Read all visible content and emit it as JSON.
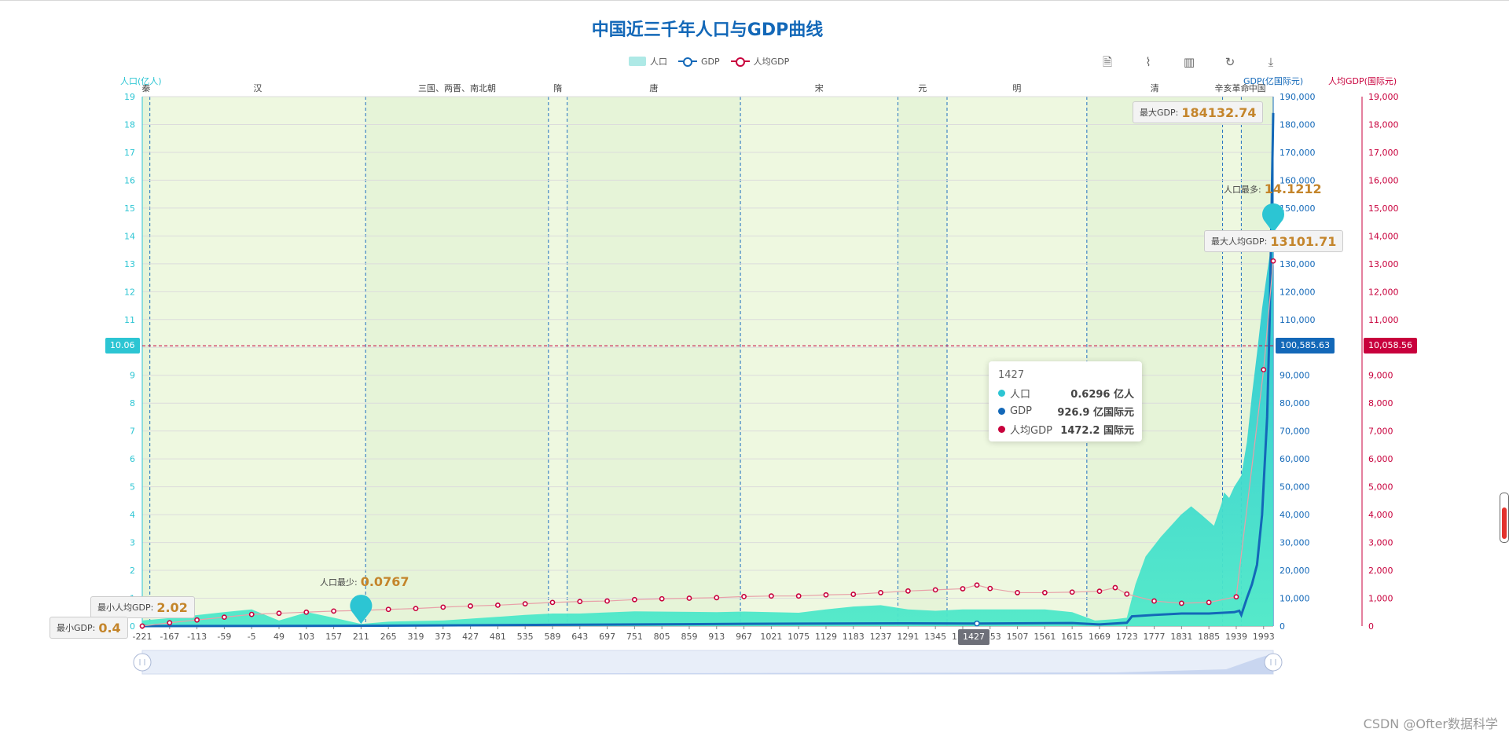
{
  "title": "中国近三千年人口与GDP曲线",
  "legend": [
    {
      "label": "人口",
      "color": "#2cc5d3"
    },
    {
      "label": "GDP",
      "color": "#1368b8"
    },
    {
      "label": "人均GDP",
      "color": "#c8003c"
    }
  ],
  "toolbox": [
    {
      "name": "data-view-icon",
      "glyph": "🗎"
    },
    {
      "name": "line-chart-icon",
      "glyph": "⌇"
    },
    {
      "name": "bar-chart-icon",
      "glyph": "▥"
    },
    {
      "name": "restore-icon",
      "glyph": "↻"
    },
    {
      "name": "save-image-icon",
      "glyph": "⤓"
    }
  ],
  "colors": {
    "population": "#2cc5d3",
    "gdp": "#1368b8",
    "gdp_per_capita": "#c8003c",
    "dynasty_band_1": "#e6f4d8",
    "dynasty_band_2": "#eef8e0"
  },
  "chart_data": {
    "type": "line",
    "title": "中国近三千年人口与GDP曲线",
    "x_tick_labels": [
      "-221",
      "-167",
      "-113",
      "-59",
      "-5",
      "49",
      "103",
      "157",
      "211",
      "265",
      "319",
      "373",
      "427",
      "481",
      "535",
      "589",
      "643",
      "697",
      "751",
      "805",
      "859",
      "913",
      "967",
      "1021",
      "1075",
      "1129",
      "1183",
      "1237",
      "1291",
      "1345",
      "1399",
      "1453",
      "1507",
      "1561",
      "1615",
      "1669",
      "1723",
      "1777",
      "1831",
      "1885",
      "1939",
      "1993"
    ],
    "xlim": [
      -221,
      2012
    ],
    "y_axes": [
      {
        "label": "人口(亿人)",
        "min": 0,
        "max": 19,
        "ticks": [
          "0",
          "1",
          "2",
          "3",
          "4",
          "5",
          "6",
          "7",
          "8",
          "9",
          "10",
          "11",
          "12",
          "13",
          "14",
          "15",
          "16",
          "17",
          "18",
          "19"
        ]
      },
      {
        "label": "GDP(亿国际元)",
        "min": 0,
        "max": 190000,
        "ticks": [
          "0",
          "10,000",
          "20,000",
          "30,000",
          "40,000",
          "50,000",
          "60,000",
          "70,000",
          "80,000",
          "90,000",
          "100,000",
          "110,000",
          "120,000",
          "130,000",
          "140,000",
          "150,000",
          "160,000",
          "170,000",
          "180,000",
          "190,000"
        ]
      },
      {
        "label": "人均GDP(国际元)",
        "min": 0,
        "max": 19000,
        "ticks": [
          "0",
          "1,000",
          "2,000",
          "3,000",
          "4,000",
          "5,000",
          "6,000",
          "7,000",
          "8,000",
          "9,000",
          "10,000",
          "11,000",
          "12,000",
          "13,000",
          "14,000",
          "15,000",
          "16,000",
          "17,000",
          "18,000",
          "19,000"
        ]
      }
    ],
    "dynasties": [
      {
        "name": "秦",
        "start": -221,
        "end": -206
      },
      {
        "name": "汉",
        "start": -206,
        "end": 220
      },
      {
        "name": "三国、两晋、南北朝",
        "start": 220,
        "end": 581
      },
      {
        "name": "隋",
        "start": 581,
        "end": 618
      },
      {
        "name": "唐",
        "start": 618,
        "end": 960
      },
      {
        "name": "宋",
        "start": 960,
        "end": 1271
      },
      {
        "name": "元",
        "start": 1271,
        "end": 1368
      },
      {
        "name": "明",
        "start": 1368,
        "end": 1644
      },
      {
        "name": "清",
        "start": 1644,
        "end": 1912
      },
      {
        "name": "辛亥革命",
        "start": 1912,
        "end": 1949
      },
      {
        "name": "中国",
        "start": 1949,
        "end": 2012
      }
    ],
    "series": [
      {
        "name": "人口",
        "type": "area",
        "axis": 0,
        "x": [
          -221,
          -160,
          -60,
          -5,
          49,
          105,
          157,
          211,
          265,
          373,
          535,
          589,
          643,
          751,
          913,
          967,
          1075,
          1129,
          1183,
          1237,
          1291,
          1345,
          1399,
          1453,
          1561,
          1615,
          1660,
          1700,
          1723,
          1740,
          1760,
          1790,
          1830,
          1850,
          1870,
          1895,
          1910,
          1915,
          1925,
          1935,
          1949,
          1960,
          1970,
          1980,
          1990,
          2000,
          2012
        ],
        "values": [
          0.2,
          0.3,
          0.5,
          0.6,
          0.2,
          0.5,
          0.3,
          0.0767,
          0.16,
          0.2,
          0.4,
          0.45,
          0.45,
          0.53,
          0.5,
          0.52,
          0.48,
          0.6,
          0.7,
          0.75,
          0.6,
          0.55,
          0.6,
          0.6,
          0.6,
          0.5,
          0.2,
          0.25,
          0.3,
          1.5,
          2.5,
          3.2,
          4.0,
          4.3,
          4.0,
          3.6,
          4.4,
          4.8,
          4.6,
          5.0,
          5.4,
          6.6,
          8.3,
          9.8,
          11.4,
          12.7,
          14.1212
        ]
      },
      {
        "name": "GDP",
        "type": "line",
        "axis": 1,
        "x": [
          -221,
          211,
          589,
          967,
          1291,
          1427,
          1615,
          1669,
          1723,
          1733,
          1777,
          1831,
          1885,
          1935,
          1945,
          1949,
          1960,
          1970,
          1980,
          1990,
          2000,
          2005,
          2012
        ],
        "values": [
          0.4,
          110,
          450,
          800,
          1000,
          926.9,
          1100,
          600,
          1200,
          3500,
          4000,
          4500,
          4500,
          5000,
          5500,
          4000,
          10000,
          15000,
          22000,
          40000,
          75000,
          110000,
          184132.74
        ]
      },
      {
        "name": "人均GDP",
        "type": "line",
        "axis": 2,
        "x": [
          -221,
          -167,
          -113,
          -59,
          -5,
          49,
          103,
          157,
          211,
          265,
          319,
          373,
          427,
          481,
          535,
          589,
          643,
          697,
          751,
          805,
          859,
          913,
          967,
          1021,
          1075,
          1129,
          1183,
          1237,
          1291,
          1345,
          1399,
          1427,
          1453,
          1507,
          1561,
          1615,
          1669,
          1700,
          1723,
          1777,
          1831,
          1885,
          1939,
          1993,
          2012
        ],
        "values": [
          2.02,
          120,
          220,
          320,
          420,
          460,
          500,
          540,
          560,
          600,
          630,
          680,
          720,
          750,
          800,
          850,
          880,
          900,
          950,
          980,
          1000,
          1020,
          1060,
          1080,
          1080,
          1120,
          1140,
          1200,
          1260,
          1300,
          1340,
          1472.2,
          1350,
          1200,
          1200,
          1220,
          1250,
          1380,
          1150,
          900,
          820,
          850,
          1050,
          9200,
          13101.71
        ]
      }
    ],
    "crosshair": {
      "population": "10.06",
      "gdp": "100,585.63",
      "gdp_per_capita": "10,058.56",
      "x": "1427"
    },
    "markers": {
      "max_gdp": {
        "label": "最大GDP:",
        "value": "184132.74"
      },
      "min_gdp": {
        "label": "最小GDP:",
        "value": "0.4"
      },
      "max_population": {
        "label": "人口最多:",
        "value": "14.1212"
      },
      "min_population": {
        "label": "人口最少:",
        "value": "0.0767"
      },
      "max_gdp_per_capita": {
        "label": "最大人均GDP:",
        "value": "13101.71"
      },
      "min_gdp_per_capita": {
        "label": "最小人均GDP:",
        "value": "2.02"
      }
    }
  },
  "tooltip": {
    "title": "1427",
    "rows": [
      {
        "name": "人口",
        "value": "0.6296 亿人",
        "color": "#2cc5d3"
      },
      {
        "name": "GDP",
        "value": "926.9 亿国际元",
        "color": "#1368b8"
      },
      {
        "name": "人均GDP",
        "value": "1472.2 国际元",
        "color": "#c8003c"
      }
    ]
  },
  "watermark": "CSDN @Ofter数据科学"
}
